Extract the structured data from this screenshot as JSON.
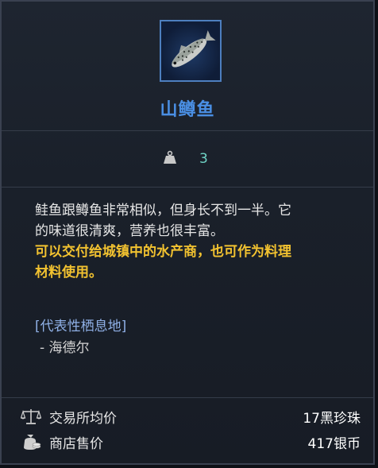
{
  "item": {
    "name": "山鳟鱼",
    "icon": "trout-fish-icon",
    "name_color": "#4a8fe4",
    "rarity_border_color": "#4d7fbf"
  },
  "weight": {
    "icon": "weight-icon",
    "value": "3"
  },
  "description": {
    "line1": "鲑鱼跟鳟鱼非常相似，但身长不到一半。它",
    "line2": "的味道很清爽，营养也很丰富。",
    "highlight_line1": "可以交付给城镇中的水产商，也可作为料理",
    "highlight_line2": "材料使用。",
    "highlight_color": "#f2c230"
  },
  "habitat": {
    "title": "[代表性栖息地]",
    "item": "- 海德尔"
  },
  "prices": {
    "market": {
      "icon": "scale-icon",
      "label": "交易所均价",
      "value": "17黑珍珠"
    },
    "shop": {
      "icon": "money-bag-icon",
      "label": "商店售价",
      "value": "417银币"
    }
  }
}
